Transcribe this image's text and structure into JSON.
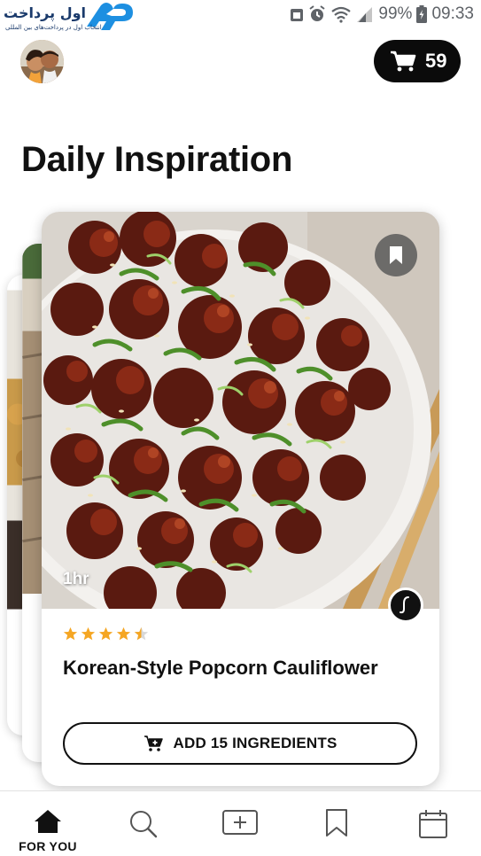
{
  "status_bar": {
    "watermark_text": "اول پرداخت",
    "watermark_subtext": "انتخاب اول در پرداخت‌های بین المللی",
    "battery": "99%",
    "time": "09:33"
  },
  "header": {
    "avatar_icon": "user-avatar",
    "cart_icon": "cart-icon",
    "cart_count": "59"
  },
  "page": {
    "title": "Daily Inspiration"
  },
  "card": {
    "time": "1hr",
    "rating": 4.5,
    "title": "Korean-Style Popcorn Cauliflower",
    "button_label": "ADD 15 INGREDIENTS",
    "bookmark_icon": "bookmark-icon",
    "source_icon": "source-logo-icon"
  },
  "nav": {
    "items": [
      {
        "label": "FOR YOU",
        "icon": "home-icon",
        "active": true
      },
      {
        "label": "",
        "icon": "search-icon",
        "active": false
      },
      {
        "label": "",
        "icon": "add-icon",
        "active": false
      },
      {
        "label": "",
        "icon": "bookmark-icon",
        "active": false
      },
      {
        "label": "",
        "icon": "calendar-icon",
        "active": false
      }
    ]
  },
  "colors": {
    "accent": "#f5a623",
    "dark": "#0b0b0b",
    "star_empty": "#d8d8d8"
  }
}
